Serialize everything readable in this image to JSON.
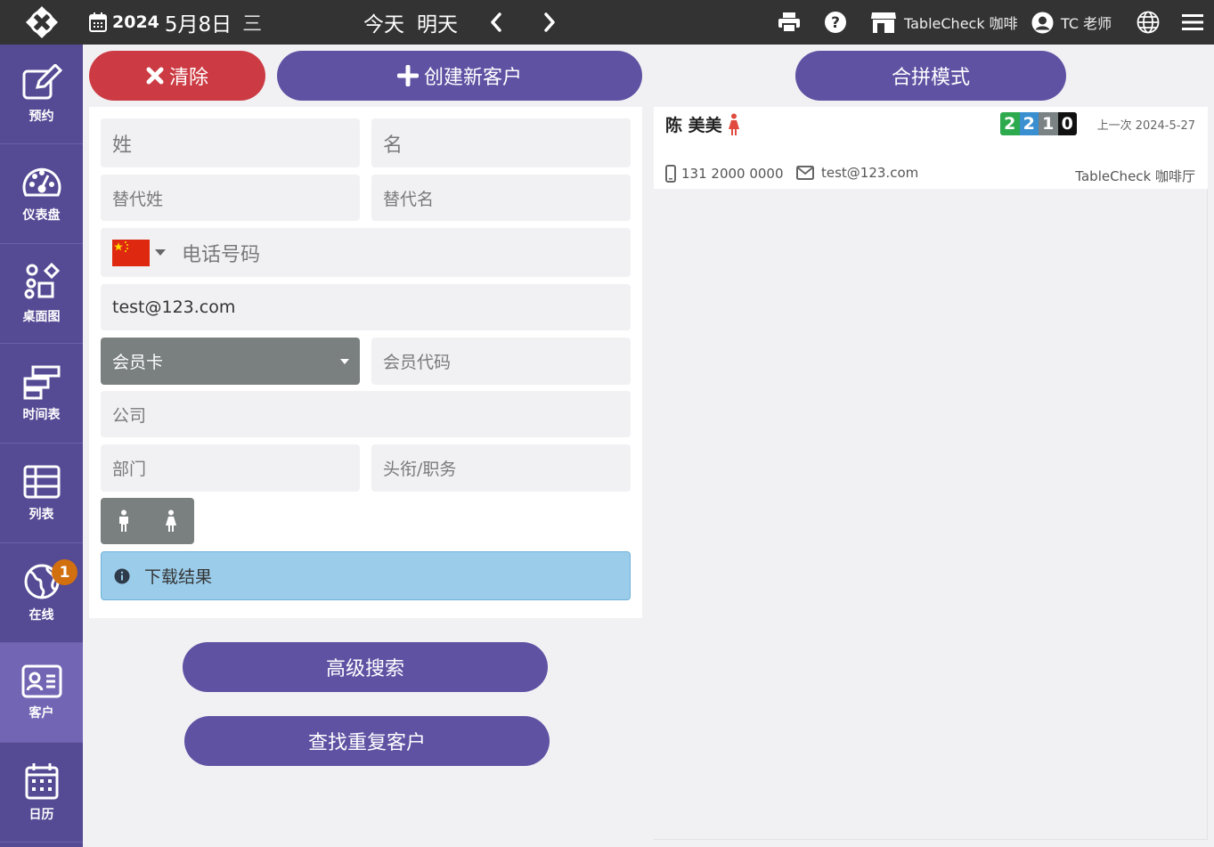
{
  "topbar": {
    "year": "2024",
    "month_day": "5月8日",
    "weekday": "三",
    "today": "今天",
    "tomorrow": "明天",
    "venue": "TableCheck 咖啡",
    "user": "TC 老师"
  },
  "sidebar": {
    "items": [
      {
        "label": "预约",
        "icon": "edit-icon"
      },
      {
        "label": "仪表盘",
        "icon": "dashboard-icon"
      },
      {
        "label": "桌面图",
        "icon": "table-map-icon"
      },
      {
        "label": "时间表",
        "icon": "timetable-icon"
      },
      {
        "label": "列表",
        "icon": "list-icon"
      },
      {
        "label": "在线",
        "icon": "globe-icon",
        "badge": "1"
      },
      {
        "label": "客户",
        "icon": "customer-card-icon",
        "active": true
      },
      {
        "label": "日历",
        "icon": "calendar-icon"
      }
    ]
  },
  "actions": {
    "clear": "清除",
    "create": "创建新客户",
    "merge": "合拼模式",
    "advanced_search": "高级搜索",
    "find_duplicates": "查找重复客户"
  },
  "form": {
    "last_name_placeholder": "姓",
    "first_name_placeholder": "名",
    "alt_last_name_placeholder": "替代姓",
    "alt_first_name_placeholder": "替代名",
    "phone_placeholder": "电话号码",
    "email_value": "test@123.com",
    "membership_select": "会员卡",
    "member_code_placeholder": "会员代码",
    "company_placeholder": "公司",
    "department_placeholder": "部门",
    "title_placeholder": "头衔/职务",
    "info_text": "下载结果"
  },
  "result": {
    "name": "陈 美美",
    "counts": [
      {
        "value": "2",
        "color": "#2eaa4e"
      },
      {
        "value": "2",
        "color": "#3a8fd0"
      },
      {
        "value": "1",
        "color": "#7a8284"
      },
      {
        "value": "0",
        "color": "#111111"
      }
    ],
    "last_visit": "上一次 2024-5-27",
    "phone": "131 2000 0000",
    "email": "test@123.com",
    "venue": "TableCheck 咖啡厅"
  },
  "colors": {
    "topbar": "#333333",
    "sidebar": "#554a94",
    "primary": "#5f52a3",
    "danger": "#cc3b43",
    "female": "#e14b3f"
  }
}
